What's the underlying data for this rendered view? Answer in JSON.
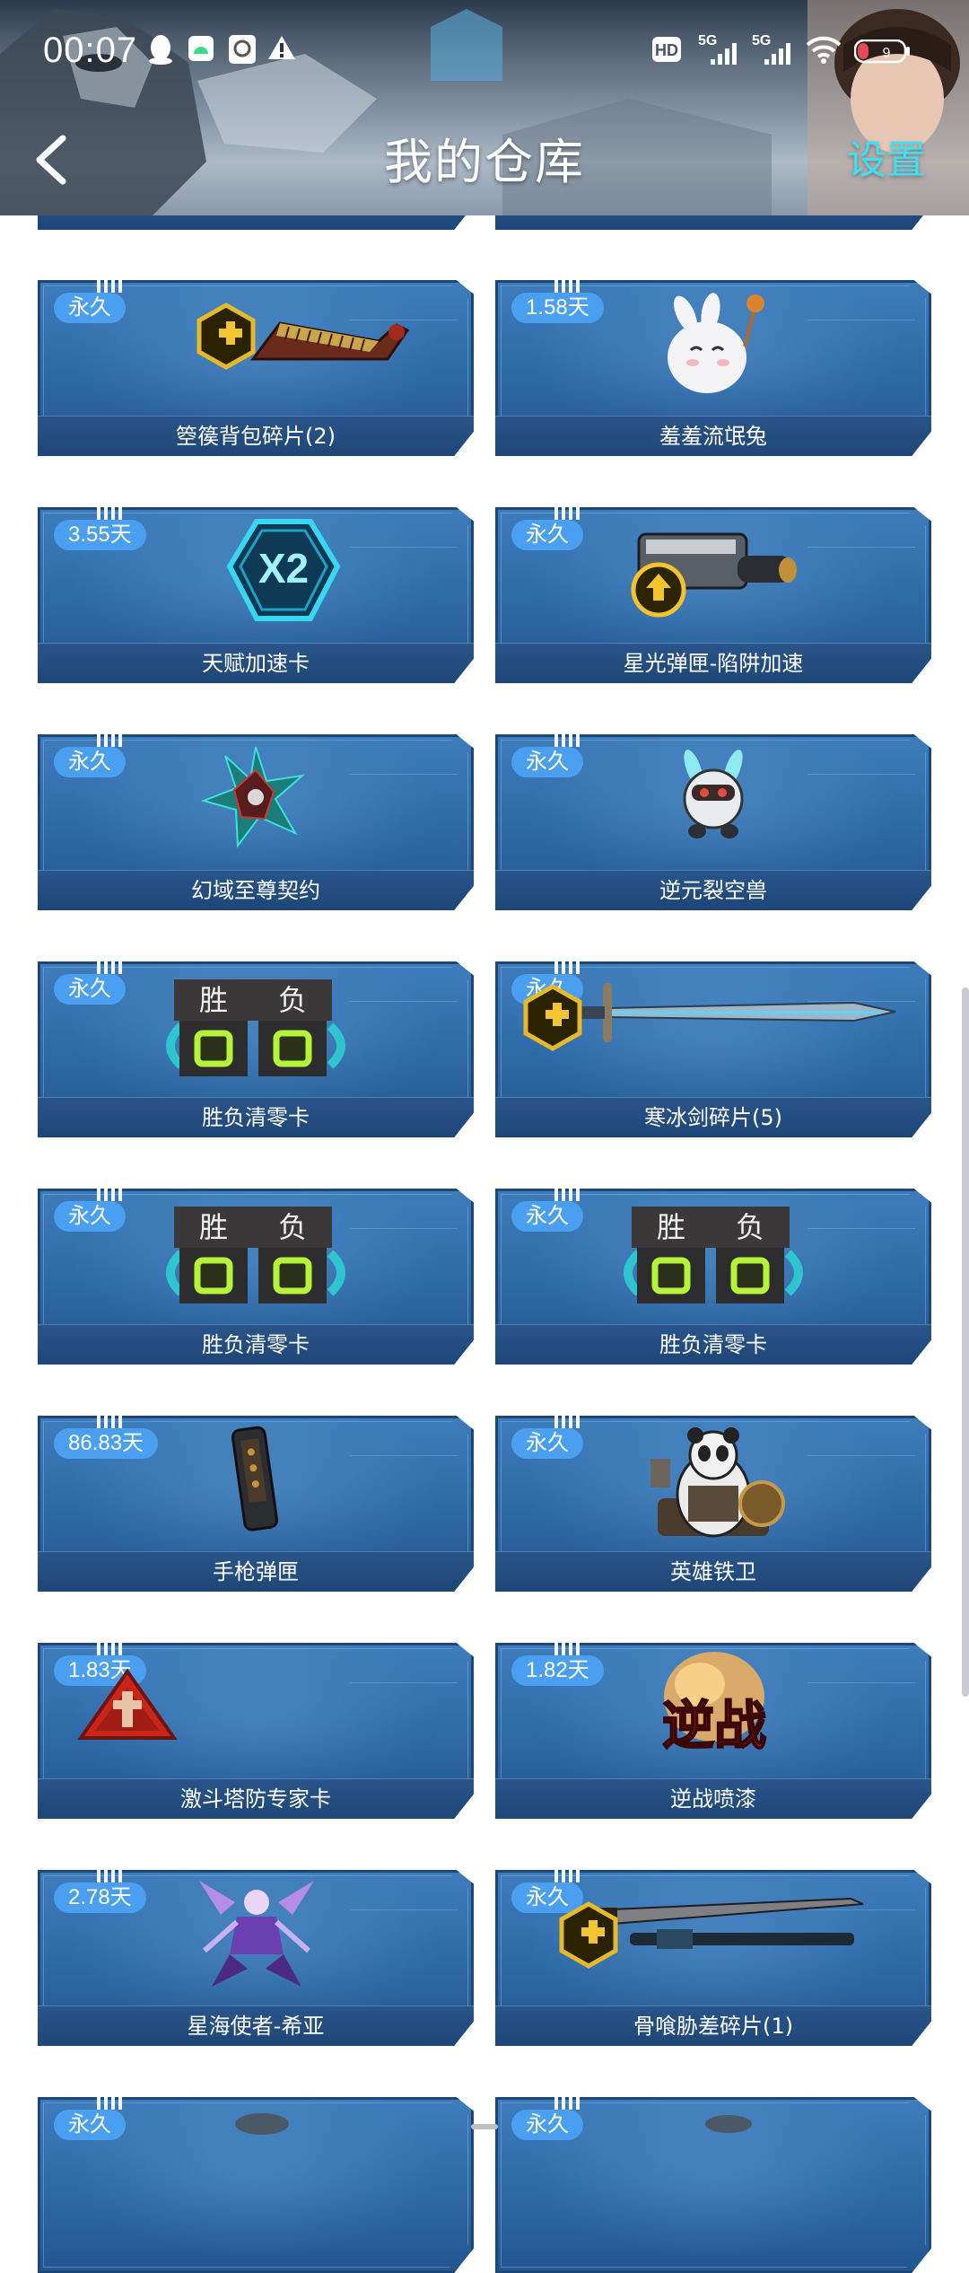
{
  "status_bar": {
    "time": "00:07",
    "hd_label": "HD",
    "net1": "5G",
    "net2": "5G",
    "battery": "9"
  },
  "nav": {
    "title": "我的仓库",
    "settings_label": "设置"
  },
  "items": [
    {
      "badge": "永久",
      "name": "箜篌背包碎片(2)",
      "icon": "harp-fragment-icon"
    },
    {
      "badge": "1.58天",
      "name": "羞羞流氓兔",
      "icon": "bunny-icon"
    },
    {
      "badge": "3.55天",
      "name": "天赋加速卡",
      "icon": "x2-boost-icon"
    },
    {
      "badge": "永久",
      "name": "星光弹匣-陷阱加速",
      "icon": "magazine-upgrade-icon"
    },
    {
      "badge": "永久",
      "name": "幻域至尊契约",
      "icon": "contract-emblem-icon"
    },
    {
      "badge": "永久",
      "name": "逆元裂空兽",
      "icon": "robot-pet-icon"
    },
    {
      "badge": "永久",
      "name": "胜负清零卡",
      "icon": "win-loss-reset-icon",
      "win": "胜",
      "loss": "负"
    },
    {
      "badge": "永久",
      "name": "寒冰剑碎片(5)",
      "icon": "ice-sword-fragment-icon"
    },
    {
      "badge": "永久",
      "name": "胜负清零卡",
      "icon": "win-loss-reset-icon",
      "win": "胜",
      "loss": "负"
    },
    {
      "badge": "永久",
      "name": "胜负清零卡",
      "icon": "win-loss-reset-icon",
      "win": "胜",
      "loss": "负"
    },
    {
      "badge": "86.83天",
      "name": "手枪弹匣",
      "icon": "pistol-magazine-icon"
    },
    {
      "badge": "永久",
      "name": "英雄铁卫",
      "icon": "panda-guard-icon"
    },
    {
      "badge": "1.83天",
      "name": "激斗塔防专家卡",
      "icon": "tower-defense-card-icon"
    },
    {
      "badge": "1.82天",
      "name": "逆战喷漆",
      "icon": "spray-logo-icon",
      "logo": "逆战"
    },
    {
      "badge": "2.78天",
      "name": "星海使者-希亚",
      "icon": "character-icon"
    },
    {
      "badge": "永久",
      "name": "骨喰胁差碎片(1)",
      "icon": "blade-fragment-icon"
    },
    {
      "badge": "永久",
      "name": "",
      "icon": "partial-item-icon"
    },
    {
      "badge": "永久",
      "name": "",
      "icon": "partial-item-icon"
    }
  ]
}
